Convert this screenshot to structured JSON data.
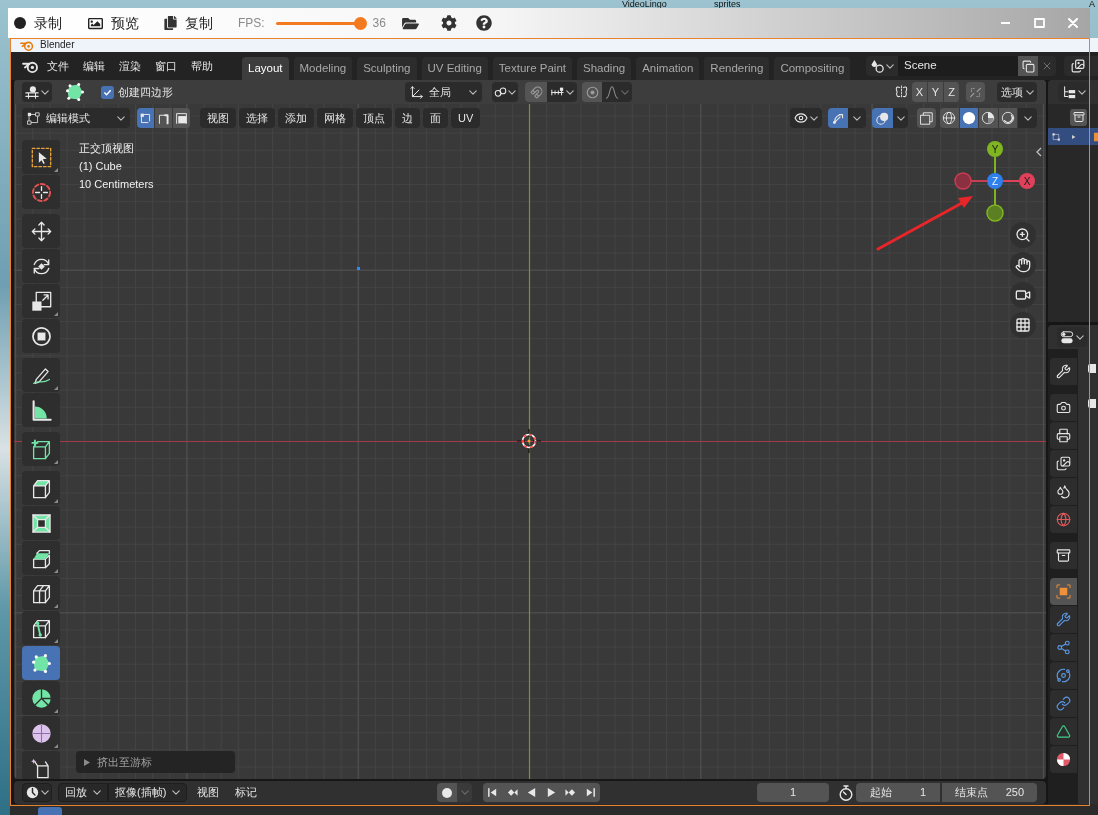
{
  "desktop": {
    "labels": [
      "VideoLingo",
      "sprites",
      "A"
    ]
  },
  "recorder": {
    "actions": [
      "录制",
      "预览",
      "复制"
    ],
    "fps": {
      "label": "FPS:",
      "level": 1,
      "reading": "36"
    }
  },
  "window": {
    "title": "Blender"
  },
  "topbar": {
    "menu": [
      "文件",
      "编辑",
      "渲染",
      "窗口",
      "帮助"
    ],
    "workspaces": [
      {
        "label": "Layout",
        "selected": true
      },
      {
        "label": "Modeling",
        "selected": false
      },
      {
        "label": "Sculpting",
        "selected": false
      },
      {
        "label": "UV Editing",
        "selected": false
      },
      {
        "label": "Texture Paint",
        "selected": false
      },
      {
        "label": "Shading",
        "selected": false
      },
      {
        "label": "Animation",
        "selected": false
      },
      {
        "label": "Rendering",
        "selected": false
      },
      {
        "label": "Compositing",
        "selected": false
      }
    ],
    "scene": "Scene"
  },
  "tool_header": {
    "create_quads": {
      "label": "创建四边形",
      "checked": true
    },
    "orientation": "全局",
    "mirror_axes": [
      {
        "label": "X",
        "selected": false
      },
      {
        "label": "Y",
        "selected": false
      },
      {
        "label": "Z",
        "selected": false
      }
    ],
    "options": "选项"
  },
  "view_header": {
    "mode": "编辑模式",
    "select_modes": [
      {
        "selected": true
      },
      {
        "selected": false
      },
      {
        "selected": false
      }
    ],
    "menus": [
      "视图",
      "选择",
      "添加",
      "网格",
      "顶点",
      "边",
      "面",
      "UV"
    ],
    "gizmos_on": true,
    "overlays_on": true,
    "shading": [
      {
        "selected": false
      },
      {
        "selected": true
      },
      {
        "selected": false
      },
      {
        "selected": false
      }
    ]
  },
  "toolbar": [
    {
      "tools": [
        {
          "selected": false
        },
        {
          "selected": false
        }
      ]
    },
    {
      "tools": [
        {
          "selected": false
        },
        {
          "selected": false
        },
        {
          "selected": false
        },
        {
          "selected": false
        }
      ]
    },
    {
      "tools": [
        {
          "selected": false
        },
        {
          "selected": false
        }
      ]
    },
    {
      "tools": [
        {
          "selected": false
        }
      ]
    },
    {
      "tools": [
        {
          "selected": false
        },
        {
          "selected": false
        },
        {
          "selected": false
        },
        {
          "selected": false
        },
        {
          "selected": false
        },
        {
          "selected": true
        },
        {
          "selected": false
        },
        {
          "selected": false
        },
        {
          "selected": false
        }
      ]
    }
  ],
  "viewport": {
    "info": [
      "正交顶视图",
      "(1) Cube",
      "10 Centimeters"
    ],
    "gizmo": {
      "top": "Y",
      "right": "X",
      "center": "Z"
    },
    "last_operator": "挤出至游标"
  },
  "timeline": {
    "menus": [
      {
        "label": "回放",
        "kind": "dropdown"
      },
      {
        "label": "抠像(插帧)",
        "kind": "dropdown"
      },
      {
        "label": "视图",
        "kind": "menu"
      },
      {
        "label": "标记",
        "kind": "menu"
      }
    ],
    "current_frame": "1",
    "start": {
      "label": "起始",
      "value": "1"
    },
    "end": {
      "label": "结束点",
      "value": "250"
    }
  },
  "outliner": {
    "rows": [
      {
        "selected": true
      }
    ]
  },
  "properties": {
    "tabs": [
      {
        "selected": false
      },
      {
        "selected": false
      },
      {
        "selected": false
      },
      {
        "selected": false
      },
      {
        "selected": false
      },
      {
        "selected": false
      },
      {
        "selected": false
      },
      {
        "selected": true
      },
      {
        "selected": false
      },
      {
        "selected": false
      },
      {
        "selected": false
      },
      {
        "selected": false
      },
      {
        "selected": false
      },
      {
        "selected": false
      }
    ]
  }
}
